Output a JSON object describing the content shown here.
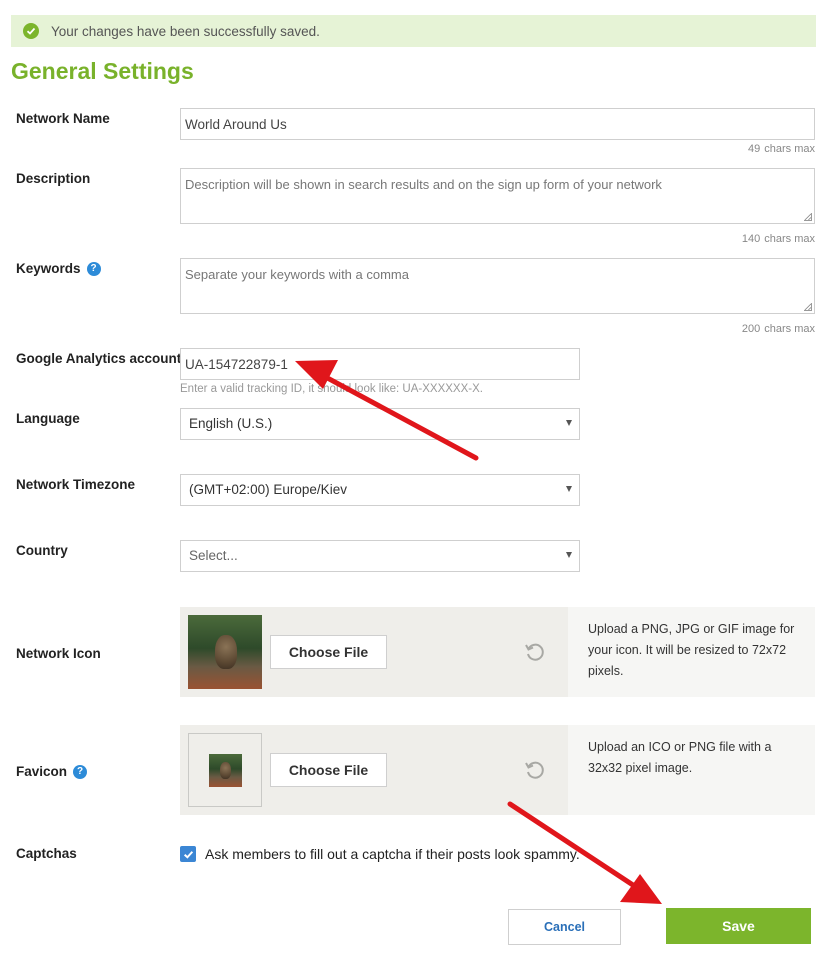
{
  "notice": {
    "message": "Your changes have been successfully saved.",
    "icon": "check-circle-icon"
  },
  "page": {
    "title": "General Settings"
  },
  "fields": {
    "network_name": {
      "label": "Network Name",
      "value": "World Around Us",
      "counter": "49",
      "counter_unit": "chars max"
    },
    "description": {
      "label": "Description",
      "placeholder": "Description will be shown in search results and on the sign up form of your network",
      "counter": "140",
      "counter_unit": "chars max"
    },
    "keywords": {
      "label": "Keywords",
      "placeholder": "Separate your keywords with a comma",
      "counter": "200",
      "counter_unit": "chars max"
    },
    "analytics": {
      "label": "Google Analytics account",
      "value": "UA-154722879-1",
      "hint": "Enter a valid tracking ID, it should look like: UA-XXXXXX-X."
    },
    "language": {
      "label": "Language",
      "selected": "English (U.S.)"
    },
    "timezone": {
      "label": "Network Timezone",
      "selected": "(GMT+02:00) Europe/Kiev"
    },
    "country": {
      "label": "Country",
      "selected": "Select..."
    },
    "network_icon": {
      "label": "Network Icon",
      "button": "Choose File",
      "info": "Upload a PNG, JPG or GIF image for your icon. It will be resized to 72x72 pixels."
    },
    "favicon": {
      "label": "Favicon",
      "button": "Choose File",
      "info": "Upload an ICO or PNG file with a 32x32 pixel image."
    },
    "captchas": {
      "label": "Captchas",
      "checked": true,
      "text": "Ask members to fill out a captcha if their posts look spammy."
    }
  },
  "actions": {
    "cancel": "Cancel",
    "save": "Save"
  },
  "colors": {
    "accent_green": "#7cb52c",
    "success_bg": "#e6f3d6",
    "help_blue": "#2d8bd8",
    "annotation_red": "#e0161b"
  }
}
